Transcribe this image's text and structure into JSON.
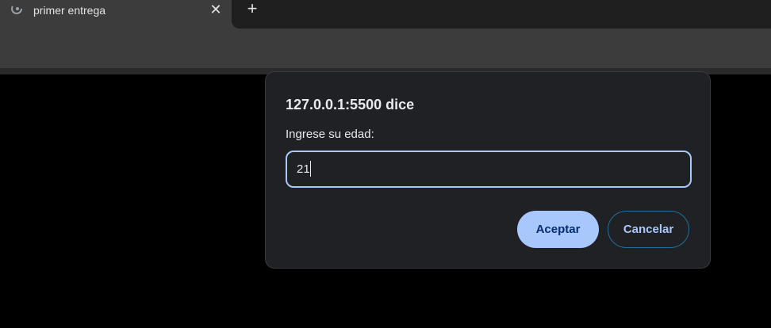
{
  "browser": {
    "tab": {
      "title": "primer entrega",
      "close_glyph": "✕",
      "favicon_icon": "loading-spinner-icon"
    },
    "new_tab_glyph": "+"
  },
  "dialog": {
    "title": "127.0.0.1:5500 dice",
    "message": "Ingrese su edad:",
    "input_value": "21",
    "accept_label": "Aceptar",
    "cancel_label": "Cancelar"
  },
  "colors": {
    "accent": "#a8c7fa",
    "accent_text": "#062e6f",
    "dialog_bg": "#202124",
    "page_bg": "#000000"
  }
}
